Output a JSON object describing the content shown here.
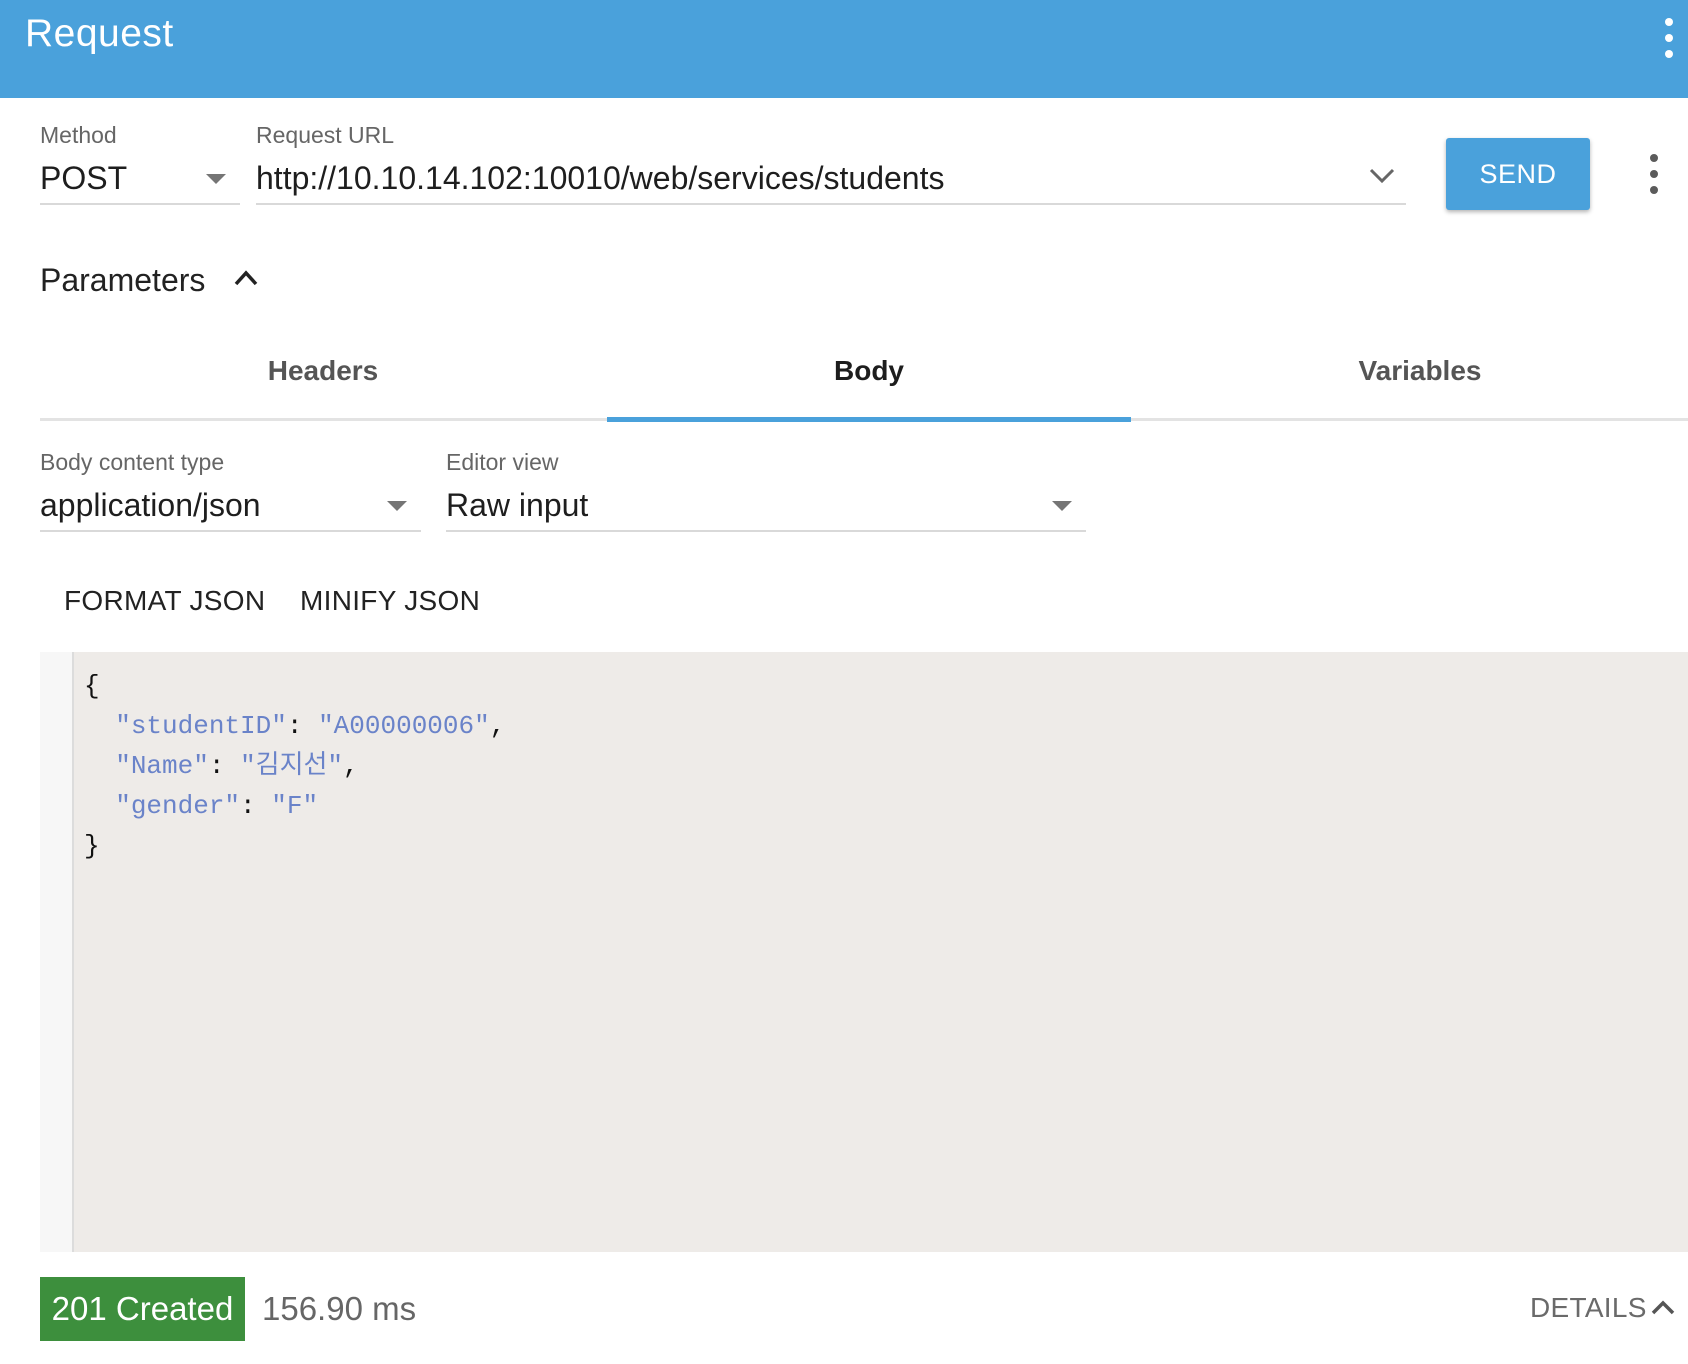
{
  "header": {
    "title": "Request",
    "menu_icon": "more-vert-icon"
  },
  "request": {
    "method_label": "Method",
    "method_value": "POST",
    "url_label": "Request URL",
    "url_value": "http://10.10.14.102:10010/web/services/students",
    "send_label": "SEND",
    "more_icon": "more-vert-icon"
  },
  "parameters": {
    "title": "Parameters",
    "expanded": true,
    "tabs": [
      {
        "label": "Headers",
        "active": false
      },
      {
        "label": "Body",
        "active": true
      },
      {
        "label": "Variables",
        "active": false
      }
    ]
  },
  "body": {
    "content_type_label": "Body content type",
    "content_type_value": "application/json",
    "editor_view_label": "Editor view",
    "editor_view_value": "Raw input",
    "format_label": "FORMAT JSON",
    "minify_label": "MINIFY JSON",
    "code": {
      "open": "{",
      "lines": [
        {
          "key": "\"studentID\"",
          "value": "\"A00000006\"",
          "comma": ","
        },
        {
          "key": "\"Name\"",
          "value": "\"김지선\"",
          "comma": ","
        },
        {
          "key": "\"gender\"",
          "value": "\"F\"",
          "comma": ""
        }
      ],
      "close": "}"
    }
  },
  "response": {
    "status": "201 Created",
    "status_color": "#3d8f3d",
    "time": "156.90 ms",
    "details_label": "DETAILS"
  },
  "colors": {
    "accent": "#4aa1db",
    "code_string": "#6a83c9"
  }
}
